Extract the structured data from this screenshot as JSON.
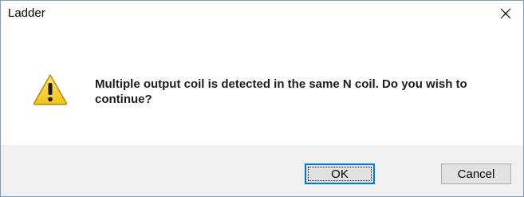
{
  "window": {
    "title": "Ladder",
    "close_icon": "close-icon"
  },
  "message": {
    "icon": "warning-icon",
    "text": "Multiple output coil is detected in the same N coil. Do you wish to continue?"
  },
  "buttons": {
    "ok_label": "OK",
    "cancel_label": "Cancel"
  },
  "colors": {
    "footer_background": "#f0f0f0",
    "default_button_border": "#0078d7",
    "warning_fill": "#f7d23a"
  }
}
